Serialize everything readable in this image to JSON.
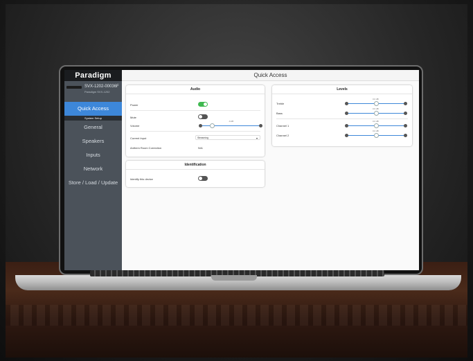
{
  "app": {
    "brand": "Paradigm",
    "page_title": "Quick Access"
  },
  "device": {
    "name": "SVX-1202-00036F",
    "model": "Paradigm SVX-1202"
  },
  "sidebar": {
    "items": [
      {
        "label": "Quick Access",
        "active": true
      },
      {
        "section": "System Setup"
      },
      {
        "label": "General"
      },
      {
        "label": "Speakers"
      },
      {
        "label": "Inputs"
      },
      {
        "label": "Network"
      },
      {
        "label": "Store / Load / Update"
      }
    ]
  },
  "audio": {
    "title": "Audio",
    "power": {
      "label": "Power",
      "on": true
    },
    "mute": {
      "label": "Mute",
      "on": false
    },
    "volume": {
      "label": "Volume",
      "value": "-9 dB",
      "fraction": 0.18
    },
    "input": {
      "label": "Current Input",
      "value": "Streaming"
    },
    "arc": {
      "label": "Anthem Room Correction",
      "value": "N/A"
    }
  },
  "identification": {
    "title": "Identification",
    "identify": {
      "label": "Identify this device",
      "on": false
    }
  },
  "levels": {
    "title": "Levels",
    "rows": [
      {
        "label": "Treble",
        "value": "0.0 dB",
        "fraction": 0.5
      },
      {
        "label": "Bass",
        "value": "0.0 dB",
        "fraction": 0.5
      },
      {
        "label": "Channel 1",
        "value": "0.0 dB",
        "fraction": 0.5
      },
      {
        "label": "Channel 2",
        "value": "0.0 dB",
        "fraction": 0.5
      }
    ]
  },
  "colors": {
    "accent": "#3d87d9",
    "toggle_on": "#3fb950",
    "sidebar": "#4b525a"
  }
}
